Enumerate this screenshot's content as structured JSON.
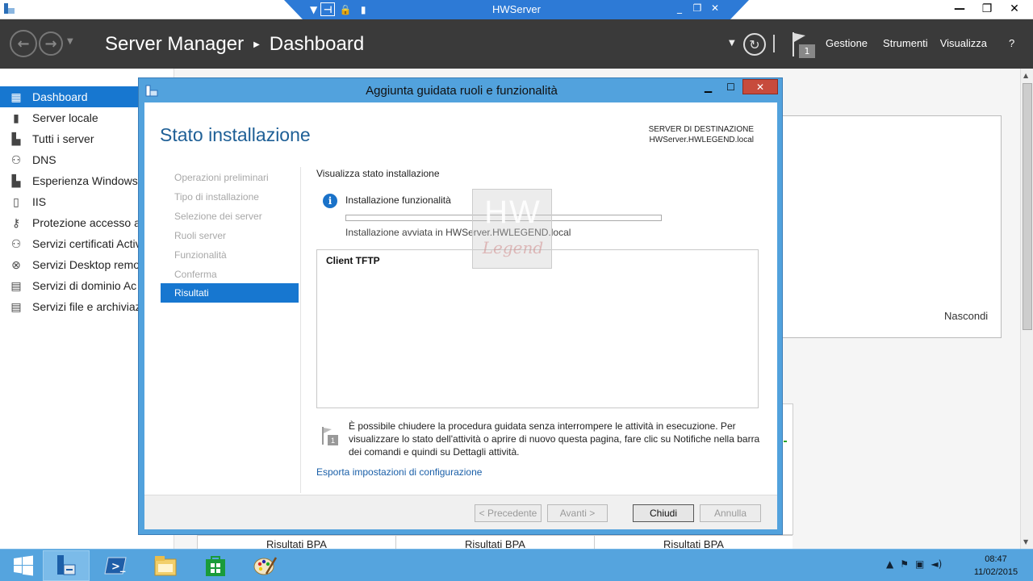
{
  "rdp": {
    "host": "HWServer"
  },
  "header": {
    "app_title": "Server Manager",
    "page": "Dashboard",
    "flag_count": "1",
    "menu": {
      "gestione": "Gestione",
      "strumenti": "Strumenti",
      "visualizza": "Visualizza",
      "help": "?"
    }
  },
  "sidebar": {
    "items": [
      {
        "label": "Dashboard",
        "icon": "dashboard-icon",
        "active": true
      },
      {
        "label": "Server locale",
        "icon": "server-icon"
      },
      {
        "label": "Tutti i server",
        "icon": "servers-icon"
      },
      {
        "label": "DNS",
        "icon": "dns-icon"
      },
      {
        "label": "Esperienza Windows",
        "icon": "windows-experience-icon"
      },
      {
        "label": "IIS",
        "icon": "iis-icon"
      },
      {
        "label": "Protezione accesso al",
        "icon": "access-protection-icon"
      },
      {
        "label": "Servizi certificati Activ",
        "icon": "certificate-icon"
      },
      {
        "label": "Servizi Desktop remo",
        "icon": "remote-desktop-icon"
      },
      {
        "label": "Servizi di dominio Ac",
        "icon": "domain-icon"
      },
      {
        "label": "Servizi file e archiviaz",
        "icon": "file-storage-icon"
      }
    ]
  },
  "dashboard": {
    "hide_link": "Nascondi",
    "bpa_labels": [
      "Risultati BPA",
      "Risultati BPA",
      "Risultati BPA"
    ]
  },
  "wizard": {
    "title": "Aggiunta guidata ruoli e funzionalità",
    "heading": "Stato installazione",
    "dest_label": "SERVER DI DESTINAZIONE",
    "dest_server": "HWServer.HWLEGEND.local",
    "steps": [
      "Operazioni preliminari",
      "Tipo di installazione",
      "Selezione dei server",
      "Ruoli server",
      "Funzionalità",
      "Conferma",
      "Risultati"
    ],
    "active_step": "Risultati",
    "view_status": "Visualizza stato installazione",
    "install_features": "Installazione funzionalità",
    "progress": 0,
    "install_started": "Installazione avviata in HWServer.HWLEGEND.local",
    "feature": "Client TFTP",
    "note": "È possibile chiudere la procedura guidata senza interrompere le attività in esecuzione. Per visualizzare lo stato dell'attività o aprire di nuovo questa pagina, fare clic su Notifiche nella barra dei comandi e quindi su Dettagli attività.",
    "note_badge": "1",
    "export_link": "Esporta impostazioni di configurazione",
    "buttons": {
      "prev": "< Precedente",
      "next": "Avanti >",
      "close": "Chiudi",
      "cancel": "Annulla"
    },
    "watermark": {
      "hw": "HW",
      "legend": "Legend"
    }
  },
  "taskbar": {
    "time": "08:47",
    "date": "11/02/2015"
  },
  "colors": {
    "accent": "#1777d0",
    "header_bg": "#3a3a3a",
    "wizard_frame": "#52a2dd",
    "taskbar": "#55a4de"
  }
}
